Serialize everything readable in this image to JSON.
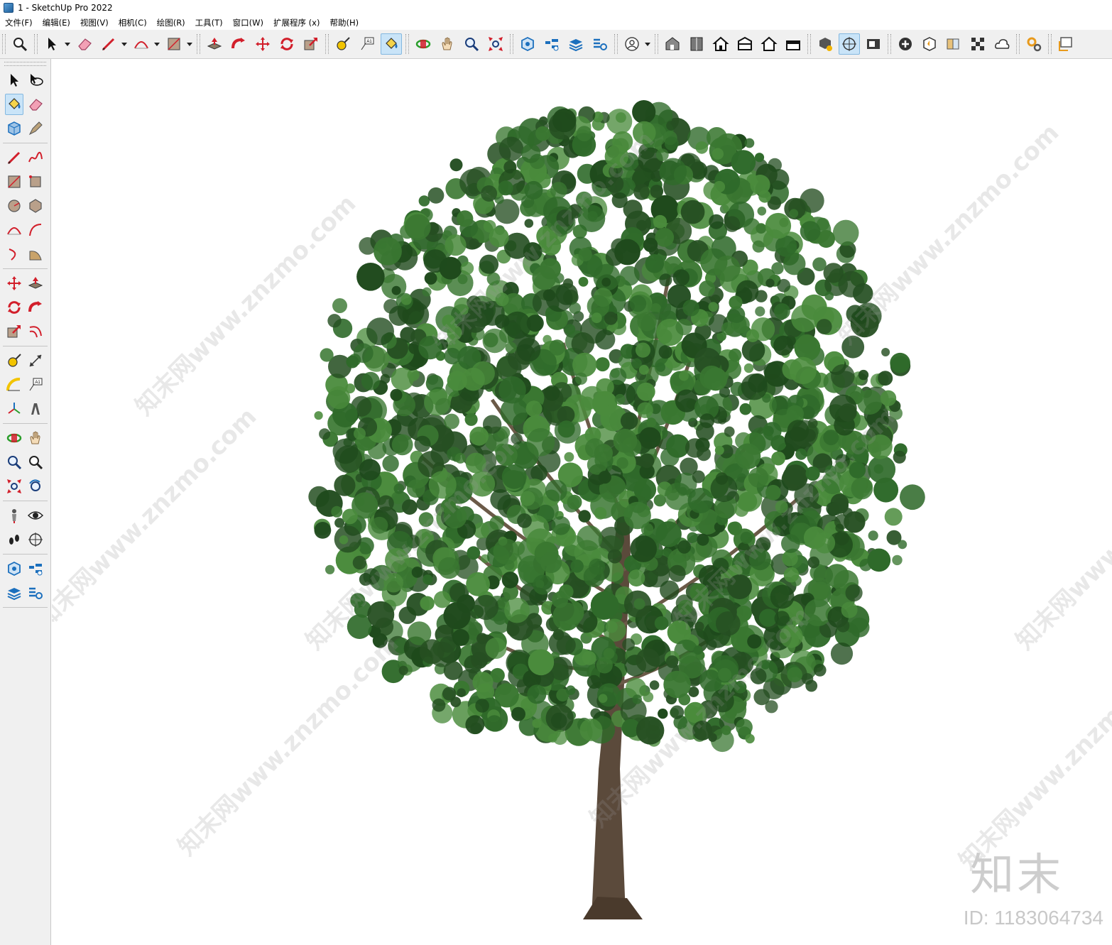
{
  "window": {
    "title": "1 - SketchUp Pro 2022"
  },
  "menu": {
    "items": [
      "文件(F)",
      "编辑(E)",
      "视图(V)",
      "相机(C)",
      "绘图(R)",
      "工具(T)",
      "窗口(W)",
      "扩展程序 (x)",
      "帮助(H)"
    ]
  },
  "toolbar": {
    "groups": [
      [
        "zoom-window-icon"
      ],
      [
        "select-icon",
        "dropdown",
        "eraser-icon",
        "pencil-line-icon",
        "dropdown",
        "arc-icon",
        "dropdown",
        "rectangle-icon",
        "dropdown"
      ],
      [
        "push-pull-icon",
        "follow-me-icon",
        "move-icon",
        "rotate-icon",
        "scale-icon"
      ],
      [
        "tape-measure-icon",
        "text-icon",
        "paint-bucket-icon"
      ],
      [
        "orbit-icon",
        "pan-icon",
        "zoom-icon",
        "zoom-extents-icon"
      ],
      [
        "3d-warehouse-icon",
        "extension-warehouse-icon",
        "layout-icon",
        "extension-manager-icon"
      ],
      [
        "account-icon",
        "dropdown"
      ],
      [
        "iso-view-icon",
        "top-view-icon",
        "front-view-icon",
        "right-view-icon",
        "back-view-icon",
        "left-view-icon"
      ],
      [
        "solid-tools-icon",
        "section-plane-icon",
        "section-cut-icon"
      ],
      [
        "add-location-icon",
        "sandbox-icon",
        "styles-icon",
        "texture-icon",
        "cloud-icon"
      ],
      [
        "settings-icon"
      ],
      [
        "window-icon"
      ]
    ],
    "active": [
      "paint-bucket-icon",
      "section-plane-icon"
    ]
  },
  "left_toolbar": {
    "groups": [
      [
        [
          "select-icon",
          "orbit-select-icon"
        ],
        [
          "paint-bucket-icon",
          "eraser-icon"
        ],
        [
          "component-icon",
          "tag-icon"
        ]
      ],
      [
        [
          "pencil-line-icon",
          "freehand-icon"
        ],
        [
          "rectangle-icon",
          "rotated-rectangle-icon"
        ],
        [
          "circle-icon",
          "polygon-icon"
        ],
        [
          "arc-icon",
          "two-point-arc-icon"
        ],
        [
          "three-point-arc-icon",
          "pie-icon"
        ]
      ],
      [
        [
          "move-icon",
          "push-pull-icon"
        ],
        [
          "rotate-icon",
          "follow-me-icon"
        ],
        [
          "scale-icon",
          "offset-icon"
        ]
      ],
      [
        [
          "tape-measure-icon",
          "dimension-icon"
        ],
        [
          "protractor-icon",
          "text-icon"
        ],
        [
          "axes-icon",
          "3d-text-icon"
        ]
      ],
      [
        [
          "orbit-icon",
          "pan-icon"
        ],
        [
          "zoom-icon",
          "zoom-window-icon"
        ],
        [
          "zoom-extents-icon",
          "previous-view-icon"
        ]
      ],
      [
        [
          "position-camera-icon",
          "look-around-icon"
        ],
        [
          "walk-icon",
          "section-plane-icon"
        ]
      ],
      [
        [
          "3d-warehouse-icon",
          "extension-warehouse-icon"
        ],
        [
          "layout-icon",
          "extension-manager-icon"
        ]
      ]
    ],
    "active": [
      "paint-bucket-icon"
    ]
  },
  "viewport": {
    "watermark": "知末网www.znzmo.com",
    "brand_mark": "知末",
    "brand_id": "ID: 1183064734"
  },
  "colors": {
    "foliage_dark": "#1f4a1c",
    "foliage_mid": "#2f6a2a",
    "foliage_light": "#4a8b3c",
    "trunk": "#5b4a3b",
    "icon_red": "#d21f2b",
    "icon_blue": "#1b6fbd"
  }
}
